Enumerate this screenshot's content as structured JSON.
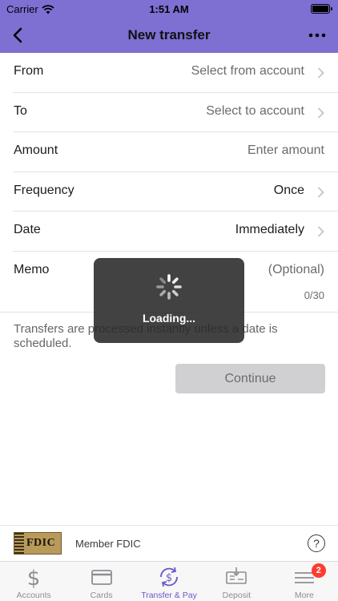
{
  "status_bar": {
    "carrier": "Carrier",
    "time": "1:51 AM"
  },
  "nav": {
    "title": "New transfer",
    "back_icon": "chevron-left-icon",
    "more_icon": "ellipsis-icon"
  },
  "form": {
    "from": {
      "label": "From",
      "value": "Select from account"
    },
    "to": {
      "label": "To",
      "value": "Select to account"
    },
    "amount": {
      "label": "Amount",
      "placeholder": "Enter amount"
    },
    "frequency": {
      "label": "Frequency",
      "value": "Once"
    },
    "date": {
      "label": "Date",
      "value": "Immediately"
    },
    "memo": {
      "label": "Memo",
      "placeholder": "(Optional)",
      "count": "0/30"
    }
  },
  "note": "Transfers are processed instantly unless a date is scheduled.",
  "continue_label": "Continue",
  "loading": {
    "text": "Loading..."
  },
  "footer": {
    "logo_text": "FDIC",
    "member_text": "Member FDIC",
    "help_icon": "?"
  },
  "tabs": [
    {
      "label": "Accounts",
      "icon": "dollar-icon"
    },
    {
      "label": "Cards",
      "icon": "card-icon"
    },
    {
      "label": "Transfer & Pay",
      "icon": "transfer-icon",
      "active": true
    },
    {
      "label": "Deposit",
      "icon": "check-deposit-icon"
    },
    {
      "label": "More",
      "icon": "menu-icon",
      "badge": "2"
    }
  ],
  "colors": {
    "header": "#7e6fd3",
    "active_tab": "#6b57c8",
    "badge": "#ff3b30"
  }
}
